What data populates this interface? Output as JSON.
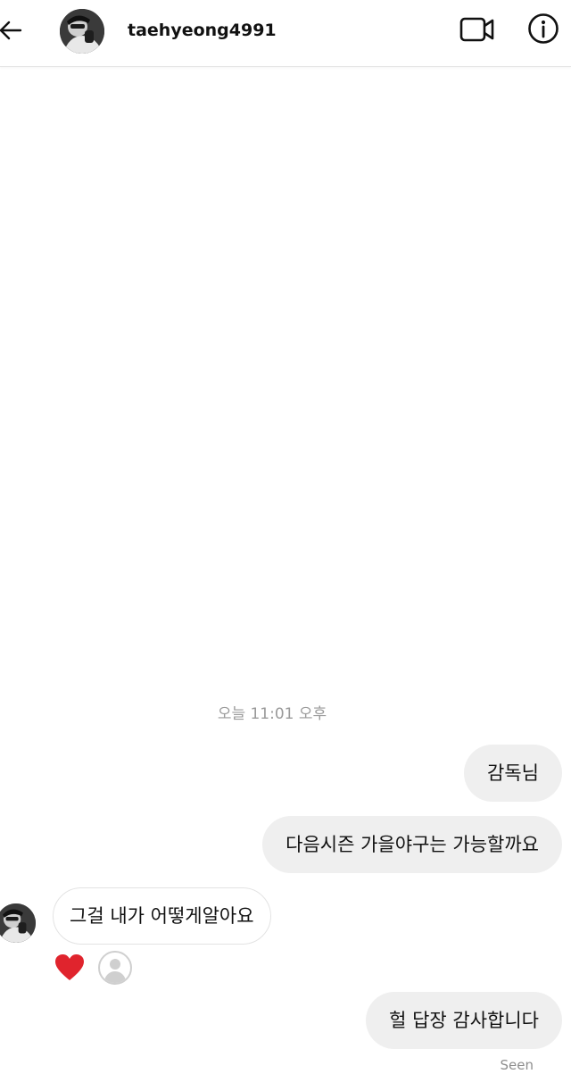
{
  "header": {
    "username": "taehyeong4991",
    "back_icon": "arrow-left-icon",
    "video_icon": "video-camera-icon",
    "info_icon": "info-circle-icon"
  },
  "conversation": {
    "timestamp": "오늘 11:01 오후",
    "messages": [
      {
        "direction": "outgoing",
        "text": "감독님"
      },
      {
        "direction": "outgoing",
        "text": "다음시즌 가을야구는 가능할까요"
      },
      {
        "direction": "incoming",
        "text": "그걸 내가 어떻게알아요"
      },
      {
        "direction": "outgoing",
        "text": "헐 답장 감사합니다"
      }
    ],
    "reaction": {
      "emoji_icon": "heart-icon",
      "color": "#e0242d",
      "reactor_icon": "default-avatar-icon"
    },
    "seen_label": "Seen"
  },
  "colors": {
    "outgoing_bubble": "#efefef",
    "incoming_border": "#e3e3e3",
    "timestamp_text": "#9a9a9a"
  }
}
